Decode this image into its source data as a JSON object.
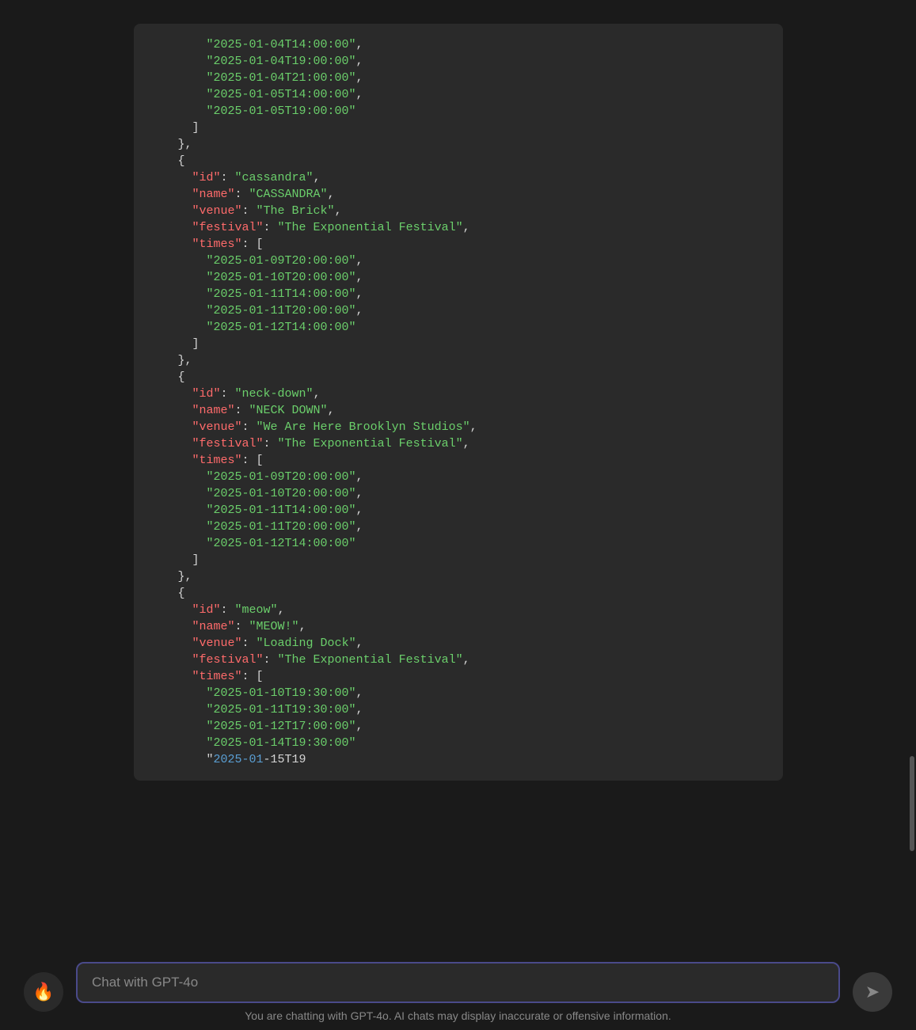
{
  "code": {
    "events": [
      {
        "partial_times_open": true,
        "times": [
          "2025-01-04T14:00:00",
          "2025-01-04T19:00:00",
          "2025-01-04T21:00:00",
          "2025-01-05T14:00:00",
          "2025-01-05T19:00:00"
        ]
      },
      {
        "id": "cassandra",
        "name": "CASSANDRA",
        "venue": "The Brick",
        "festival": "The Exponential Festival",
        "times": [
          "2025-01-09T20:00:00",
          "2025-01-10T20:00:00",
          "2025-01-11T14:00:00",
          "2025-01-11T20:00:00",
          "2025-01-12T14:00:00"
        ]
      },
      {
        "id": "neck-down",
        "name": "NECK DOWN",
        "venue": "We Are Here Brooklyn Studios",
        "festival": "The Exponential Festival",
        "times": [
          "2025-01-09T20:00:00",
          "2025-01-10T20:00:00",
          "2025-01-11T14:00:00",
          "2025-01-11T20:00:00",
          "2025-01-12T14:00:00"
        ]
      },
      {
        "id": "meow",
        "name": "MEOW!",
        "venue": "Loading Dock",
        "festival": "The Exponential Festival",
        "times": [
          "2025-01-10T19:30:00",
          "2025-01-11T19:30:00",
          "2025-01-12T17:00:00",
          "2025-01-14T19:30:00"
        ],
        "partial_time_prefix": "2025-01",
        "partial_time_suffix": "-15T19"
      }
    ]
  },
  "input": {
    "placeholder": "Chat with GPT-4o"
  },
  "fire_icon": "🔥",
  "send_icon": "➤",
  "disclaimer": "You are chatting with GPT-4o. AI chats may display inaccurate or offensive information."
}
